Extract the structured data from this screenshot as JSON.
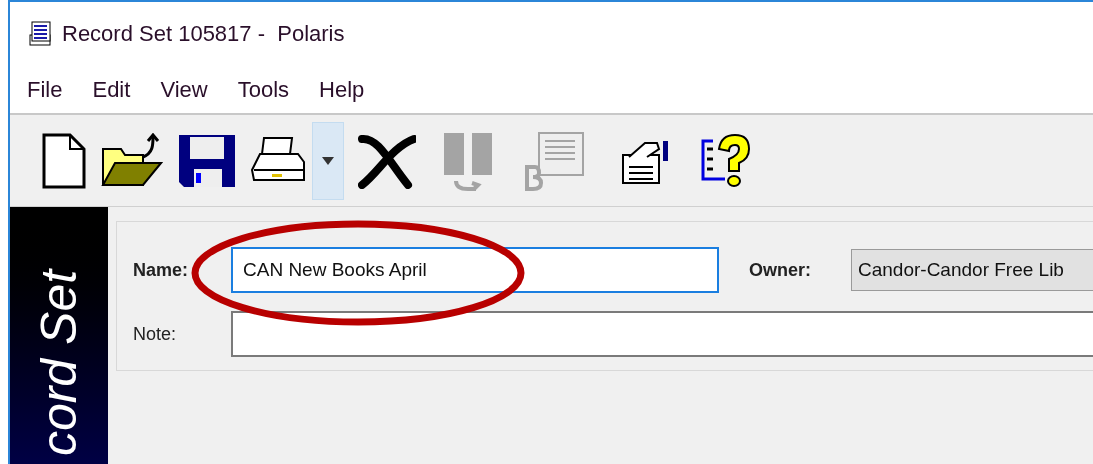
{
  "window": {
    "title": "Record Set 105817 -  Polaris"
  },
  "menu": [
    "File",
    "Edit",
    "View",
    "Tools",
    "Help"
  ],
  "toolbar": [
    {
      "kind": "new",
      "disabled": false,
      "hovered": false
    },
    {
      "kind": "open",
      "disabled": false,
      "hovered": false
    },
    {
      "kind": "save",
      "disabled": false,
      "hovered": false
    },
    {
      "kind": "print",
      "disabled": false,
      "hovered": false
    },
    {
      "kind": "dropdown",
      "disabled": false,
      "hovered": true
    },
    {
      "kind": "delete",
      "disabled": false,
      "hovered": false
    },
    {
      "kind": "columns",
      "disabled": true,
      "hovered": false
    },
    {
      "kind": "list",
      "disabled": true,
      "hovered": false
    },
    {
      "kind": "properties",
      "disabled": false,
      "hovered": false
    },
    {
      "kind": "help",
      "disabled": false,
      "hovered": false
    }
  ],
  "sidebar": {
    "title": "cord Set"
  },
  "form": {
    "name_label": "Name:",
    "name_value": "CAN New Books April",
    "name_focused": true,
    "owner_label": "Owner:",
    "owner_value": "Candor-Candor Free Lib",
    "note_label": "Note:"
  },
  "annotation": {
    "kind": "ellipse"
  }
}
